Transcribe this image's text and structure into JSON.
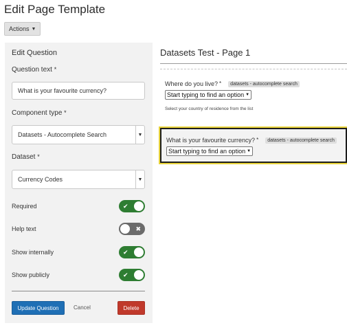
{
  "page": {
    "title": "Edit Page Template",
    "actions_label": "Actions"
  },
  "editor": {
    "panel_title": "Edit Question",
    "question_text_label": "Question text",
    "question_text_value": "What is your favourite currency?",
    "component_type_label": "Component type",
    "component_type_value": "Datasets - Autocomplete Search",
    "dataset_label": "Dataset",
    "dataset_value": "Currency Codes",
    "required_marker": "*",
    "toggles": [
      {
        "label": "Required",
        "state": "on",
        "mark": "✔"
      },
      {
        "label": "Help text",
        "state": "off",
        "mark": "✖"
      },
      {
        "label": "Show internally",
        "state": "on",
        "mark": "✔"
      },
      {
        "label": "Show publicly",
        "state": "on",
        "mark": "✔"
      }
    ],
    "update_label": "Update Question",
    "cancel_label": "Cancel",
    "delete_label": "Delete"
  },
  "preview": {
    "title": "Datasets Test - Page 1",
    "questions": [
      {
        "text": "Where do you live?",
        "required_marker": "*",
        "badge": "datasets - autocomplete search",
        "select_value": "Start typing to find an option",
        "help": "Select your country of residence from the list"
      },
      {
        "text": "What is your favourite currency?",
        "required_marker": "*",
        "badge": "datasets - autocomplete search",
        "select_value": "Start typing to find an option"
      }
    ]
  },
  "colors": {
    "toggle_on": "#2e7d32",
    "toggle_off": "#6b6b6b",
    "primary_button": "#1f6fb5",
    "danger_button": "#c0392b",
    "highlight_outline": "#e8d33a"
  }
}
